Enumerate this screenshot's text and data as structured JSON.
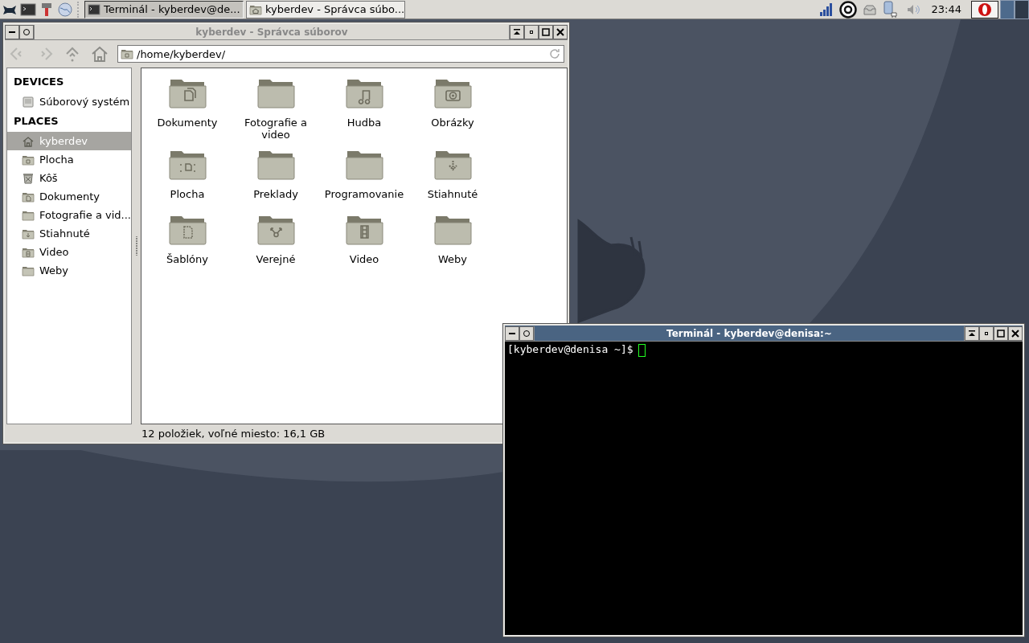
{
  "taskbar": {
    "tasks": [
      {
        "title": "Terminál - kyberdev@de...",
        "kind": "terminal",
        "selected": true
      },
      {
        "title": "kyberdev - Správca súbo...",
        "kind": "home",
        "selected": false
      }
    ],
    "clock": "23:44"
  },
  "file_manager": {
    "title": "kyberdev - Správca súborov",
    "active": false,
    "path": "/home/kyberdev/",
    "sidebar": [
      {
        "heading": "DEVICES",
        "items": [
          {
            "label": "Súborový systém",
            "kind": "drive",
            "selected": false
          }
        ]
      },
      {
        "heading": "PLACES",
        "items": [
          {
            "label": "kyberdev",
            "kind": "home",
            "selected": true
          },
          {
            "label": "Plocha",
            "kind": "desktop",
            "selected": false
          },
          {
            "label": "Kôš",
            "kind": "trash",
            "selected": false
          },
          {
            "label": "Dokumenty",
            "kind": "documents",
            "selected": false
          },
          {
            "label": "Fotografie a vid...",
            "kind": "plain",
            "selected": false
          },
          {
            "label": "Stiahnuté",
            "kind": "download",
            "selected": false
          },
          {
            "label": "Video",
            "kind": "video",
            "selected": false
          },
          {
            "label": "Weby",
            "kind": "plain",
            "selected": false
          }
        ]
      }
    ],
    "files": [
      {
        "name": "Dokumenty",
        "kind": "documents"
      },
      {
        "name": "Fotografie a video",
        "kind": "plain"
      },
      {
        "name": "Hudba",
        "kind": "music"
      },
      {
        "name": "Obrázky",
        "kind": "camera"
      },
      {
        "name": "Plocha",
        "kind": "desktop"
      },
      {
        "name": "Preklady",
        "kind": "plain"
      },
      {
        "name": "Programovanie",
        "kind": "plain"
      },
      {
        "name": "Stiahnuté",
        "kind": "download"
      },
      {
        "name": "Šablóny",
        "kind": "template"
      },
      {
        "name": "Verejné",
        "kind": "share"
      },
      {
        "name": "Video",
        "kind": "video"
      },
      {
        "name": "Weby",
        "kind": "plain"
      }
    ],
    "status": "12 položiek, voľné miesto: 16,1 GB"
  },
  "terminal": {
    "title": "Terminál - kyberdev@denisa:~",
    "active": true,
    "prompt": "[kyberdev@denisa ~]$"
  }
}
